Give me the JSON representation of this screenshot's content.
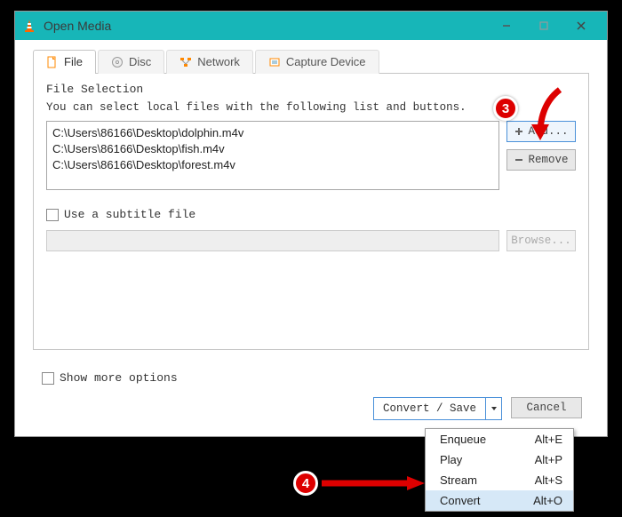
{
  "window": {
    "title": "Open Media"
  },
  "tabs": [
    {
      "label": "File"
    },
    {
      "label": "Disc"
    },
    {
      "label": "Network"
    },
    {
      "label": "Capture Device"
    }
  ],
  "file_section": {
    "title": "File Selection",
    "help": "You can select local files with the following list and buttons.",
    "files": [
      "C:\\Users\\86166\\Desktop\\dolphin.m4v",
      "C:\\Users\\86166\\Desktop\\fish.m4v",
      "C:\\Users\\86166\\Desktop\\forest.m4v"
    ],
    "add_label": "Add...",
    "remove_label": "Remove"
  },
  "subtitle": {
    "checkbox_label": "Use a subtitle file",
    "browse_label": "Browse..."
  },
  "more_options_label": "Show more options",
  "footer": {
    "convert_label": "Convert / Save",
    "cancel_label": "Cancel"
  },
  "dropdown": {
    "items": [
      {
        "label": "Enqueue",
        "shortcut": "Alt+E"
      },
      {
        "label": "Play",
        "shortcut": "Alt+P"
      },
      {
        "label": "Stream",
        "shortcut": "Alt+S"
      },
      {
        "label": "Convert",
        "shortcut": "Alt+O"
      }
    ]
  },
  "annotations": {
    "step3": "3",
    "step4": "4"
  }
}
